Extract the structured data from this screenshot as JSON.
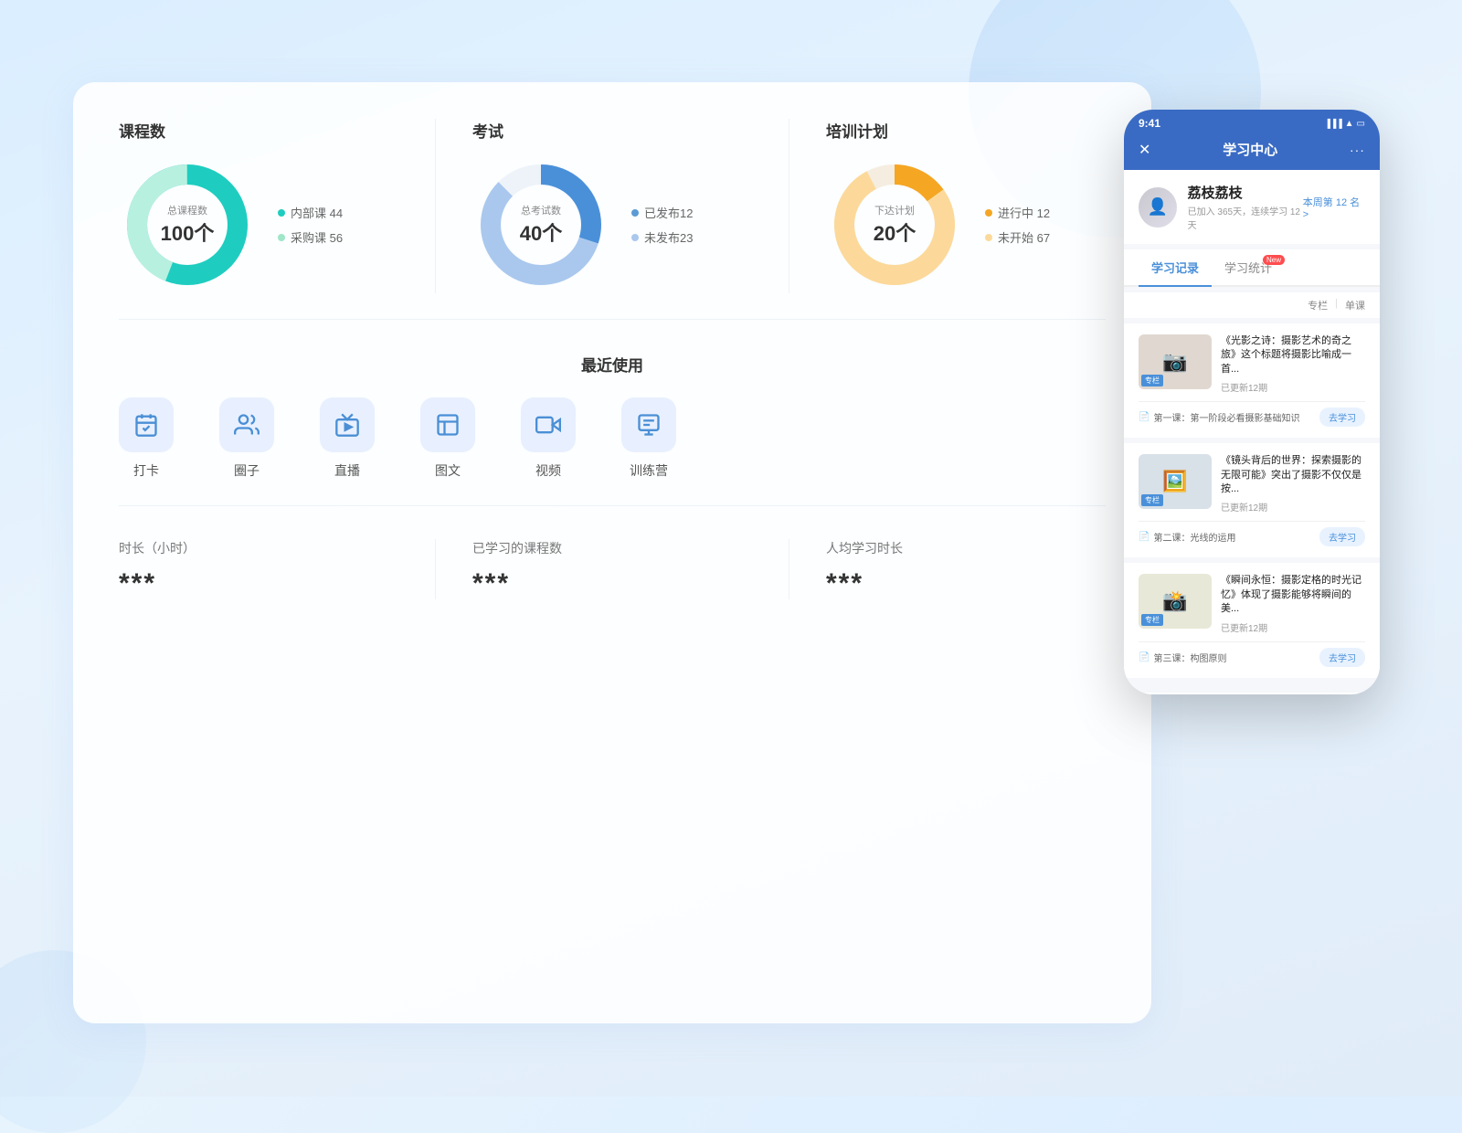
{
  "background": {
    "gradient_start": "#e8f4fd",
    "gradient_end": "#e8f0fa"
  },
  "dashboard": {
    "stats": [
      {
        "id": "courses",
        "title": "课程数",
        "center_label": "总课程数",
        "center_value": "100个",
        "legend": [
          {
            "label": "内部课 44",
            "color": "#1ecdc0"
          },
          {
            "label": "采购课 56",
            "color": "#a0e6c8"
          }
        ],
        "donut": {
          "segments": [
            {
              "value": 44,
              "color": "#1ecdc0"
            },
            {
              "value": 56,
              "color": "#b8f0e0"
            }
          ]
        }
      },
      {
        "id": "exams",
        "title": "考试",
        "center_label": "总考试数",
        "center_value": "40个",
        "legend": [
          {
            "label": "已发布12",
            "color": "#5b9bd5"
          },
          {
            "label": "未发布23",
            "color": "#aac8ee"
          }
        ],
        "donut": {
          "segments": [
            {
              "value": 12,
              "color": "#4a90d9"
            },
            {
              "value": 23,
              "color": "#aac8ee"
            },
            {
              "value": 5,
              "color": "#dde8f5"
            }
          ]
        }
      },
      {
        "id": "training",
        "title": "培训计划",
        "center_label": "下达计划",
        "center_value": "20个",
        "legend": [
          {
            "label": "进行中 12",
            "color": "#f5a623"
          },
          {
            "label": "未开始 67",
            "color": "#fcd99a"
          }
        ],
        "donut": {
          "segments": [
            {
              "value": 12,
              "color": "#f5a623"
            },
            {
              "value": 67,
              "color": "#fcd99a"
            },
            {
              "value": 8,
              "color": "#f0e0c0"
            }
          ]
        }
      }
    ],
    "recent_section_title": "最近使用",
    "recent_items": [
      {
        "id": "checkin",
        "label": "打卡",
        "icon": "checkin"
      },
      {
        "id": "circle",
        "label": "圈子",
        "icon": "circle"
      },
      {
        "id": "live",
        "label": "直播",
        "icon": "live"
      },
      {
        "id": "graphic",
        "label": "图文",
        "icon": "graphic"
      },
      {
        "id": "video",
        "label": "视频",
        "icon": "video"
      },
      {
        "id": "camp",
        "label": "训练营",
        "icon": "camp"
      }
    ],
    "bottom_stats": [
      {
        "label": "时长（小时）",
        "value": "***"
      },
      {
        "label": "已学习的课程数",
        "value": "***"
      },
      {
        "label": "人均学习时长",
        "value": "***"
      }
    ]
  },
  "phone": {
    "time": "9:41",
    "title": "学习中心",
    "close_icon": "✕",
    "more_icon": "···",
    "rank_text": "本周第 12 名 >",
    "user_name": "荔枝荔枝",
    "user_stats": "已加入 365天，连续学习 12天",
    "tabs": [
      {
        "label": "学习记录",
        "active": true
      },
      {
        "label": "学习统计",
        "active": false,
        "badge": "New"
      }
    ],
    "filter_options": [
      "专栏",
      "单课"
    ],
    "courses": [
      {
        "title": "《光影之诗：摄影艺术的奇之旅》这个标题将摄影比喻成一首...",
        "update": "已更新12期",
        "lesson": "第一课：第一阶段必看摄影基础知识",
        "action": "去学习",
        "tag": "专栏",
        "bg": "#e8e0d8",
        "emoji": "📷"
      },
      {
        "title": "《镜头背后的世界：探索摄影的无限可能》突出了摄影不仅仅是按...",
        "update": "已更新12期",
        "lesson": "第二课：光线的运用",
        "action": "去学习",
        "tag": "专栏",
        "bg": "#d8e0e8",
        "emoji": "🖼️"
      },
      {
        "title": "《瞬间永恒：摄影定格的时光记忆》体现了摄影能够将瞬间的美...",
        "update": "已更新12期",
        "lesson": "第三课：构图原则",
        "action": "去学习",
        "tag": "专栏",
        "bg": "#e8e8e0",
        "emoji": "📸"
      }
    ]
  }
}
